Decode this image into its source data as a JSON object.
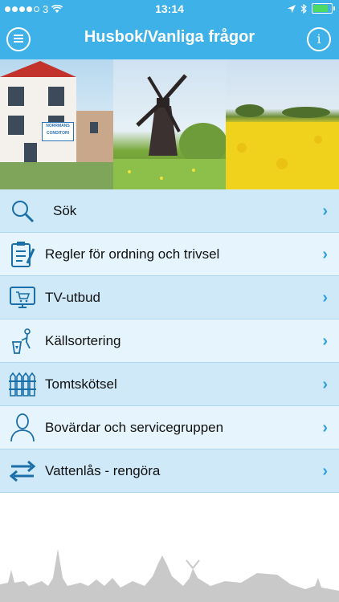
{
  "status": {
    "carrier": "3",
    "time": "13:14"
  },
  "header": {
    "title": "Husbok/Vanliga frågor",
    "info_label": "i"
  },
  "banner": {
    "panels": [
      {
        "name": "houses-photo",
        "sign_line1": "NORRMANS",
        "sign_line2": "CONDITORI"
      },
      {
        "name": "windmill-photo"
      },
      {
        "name": "rapeseed-field-photo"
      }
    ]
  },
  "menu": {
    "items": [
      {
        "label": "Sök",
        "icon": "search-icon"
      },
      {
        "label": "Regler för ordning och trivsel",
        "icon": "clipboard-icon"
      },
      {
        "label": "TV-utbud",
        "icon": "tv-icon"
      },
      {
        "label": "Källsortering",
        "icon": "recycling-icon"
      },
      {
        "label": "Tomtskötsel",
        "icon": "fence-icon"
      },
      {
        "label": "Bovärdar och servicegruppen",
        "icon": "person-icon"
      },
      {
        "label": "Vattenlås - rengöra",
        "icon": "swap-arrows-icon"
      }
    ]
  },
  "colors": {
    "accent": "#3db1e8",
    "row_alt": "#cfe9f9",
    "row_light": "#e6f5fd",
    "chevron": "#2b9fe0",
    "icon": "#1a6fa8"
  }
}
